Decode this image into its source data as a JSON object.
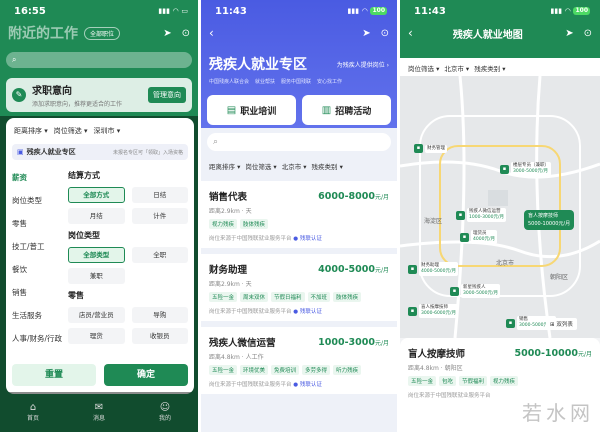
{
  "p1": {
    "time": "16:55",
    "title": "附近的工作",
    "pill": "全部职位",
    "search_placeholder": "搜索职位名称",
    "intent": {
      "title": "求职意向",
      "sub": "添加求职意向，推荐更适合的工作",
      "btn": "管理意向"
    },
    "sheet": {
      "filters": [
        "距离排序 ▾",
        "岗位筛选 ▾",
        "深圳市 ▾"
      ],
      "zone_title": "残疾人就业专区",
      "zone_sub": "未报名专区可「领取」入场资格",
      "left_menu": [
        "薪资",
        "岗位类型",
        "零售",
        "技工/普工",
        "餐饮",
        "销售",
        "生活服务",
        "人事/财务/行政"
      ],
      "sections": [
        {
          "title": "结算方式",
          "options": [
            "全部方式",
            "日结",
            "月结",
            "计件"
          ]
        },
        {
          "title": "岗位类型",
          "options": [
            "全部类型",
            "全职",
            "兼职"
          ]
        },
        {
          "title": "零售",
          "options": [
            "店员/营业员",
            "导购",
            "理货",
            "收银员"
          ]
        }
      ],
      "reset": "重置",
      "confirm": "确定"
    },
    "tabs": [
      "首页",
      "消息",
      "我的"
    ]
  },
  "p2": {
    "time": "11:43",
    "battery": "100",
    "title": "残疾人就业专区",
    "link": "为残疾人提供岗位 ›",
    "tags": [
      "中国残疾人联合会",
      "就业帮扶",
      "服务中国残联",
      "安心找工作"
    ],
    "cards": [
      "职业培训",
      "招聘活动"
    ],
    "search_placeholder": "搜索",
    "filters": [
      "距离排序 ▾",
      "岗位筛选 ▾",
      "北京市 ▾",
      "残疾类别 ▾"
    ],
    "jobs": [
      {
        "name": "销售代表",
        "salary": "6000-8000",
        "unit": "元/月",
        "dist": "距离2.9km · 天",
        "tags": [
          "视力残疾",
          "肢体残疾"
        ],
        "src": "岗位来源于中国残联就业服务平台",
        "verify": "● 残联认证"
      },
      {
        "name": "财务助理",
        "salary": "4000-5000",
        "unit": "元/月",
        "dist": "距离2.9km · 天",
        "tags": [
          "五险一金",
          "周末双休",
          "节假日福利",
          "不加班",
          "肢体残疾"
        ],
        "src": "岗位来源于中国残联就业服务平台",
        "verify": "● 残联认证"
      },
      {
        "name": "残疾人微信运营",
        "salary": "1000-3000",
        "unit": "元/月",
        "dist": "距离4.8km · 人工作",
        "tags": [
          "五险一金",
          "环境优美",
          "免费培训",
          "多劳多得",
          "听力残疾"
        ],
        "src": "岗位来源于中国残联就业服务平台",
        "verify": "● 残联认证"
      }
    ]
  },
  "p3": {
    "time": "11:43",
    "battery": "100",
    "title": "残疾人就业地图",
    "filters": [
      "岗位筛选 ▾",
      "北京市 ▾",
      "残疾类别 ▾"
    ],
    "markers": [
      {
        "name": "财务管理",
        "sal": "",
        "pos": "m1"
      },
      {
        "name": "楼层专员（兼职）",
        "sal": "3000-5000元/月",
        "pos": "m2"
      },
      {
        "name": "残疾人微信运营",
        "sal": "1000-3000元/月",
        "pos": "m3"
      },
      {
        "name": "理货员",
        "sal": "4000元/月",
        "pos": "m4"
      },
      {
        "name": "财务助理",
        "sal": "4000-5000元/月",
        "pos": "m5"
      },
      {
        "name": "新星残疾人",
        "sal": "3000-5000元/月",
        "pos": "m6"
      },
      {
        "name": "盲人按摩技师",
        "sal": "3000-6000元/月",
        "pos": "m7"
      },
      {
        "name": "销售",
        "sal": "3000-5000元/月",
        "pos": "m8"
      }
    ],
    "map_labels": [
      "海淀区",
      "北京市",
      "朝阳区"
    ],
    "big_marker": {
      "name": "盲人按摩技师",
      "sal": "5000-10000元/月"
    },
    "legend": "⊞ 双列表",
    "card": {
      "name": "盲人按摩技师",
      "salary": "5000-10000",
      "unit": "元/月",
      "dist": "距离4.8km · 朝阳区",
      "tags": [
        "五险一金",
        "包吃",
        "节假福利",
        "视力残疾"
      ],
      "src": "岗位来源于中国残联就业服务平台"
    }
  },
  "watermark": "若水网"
}
